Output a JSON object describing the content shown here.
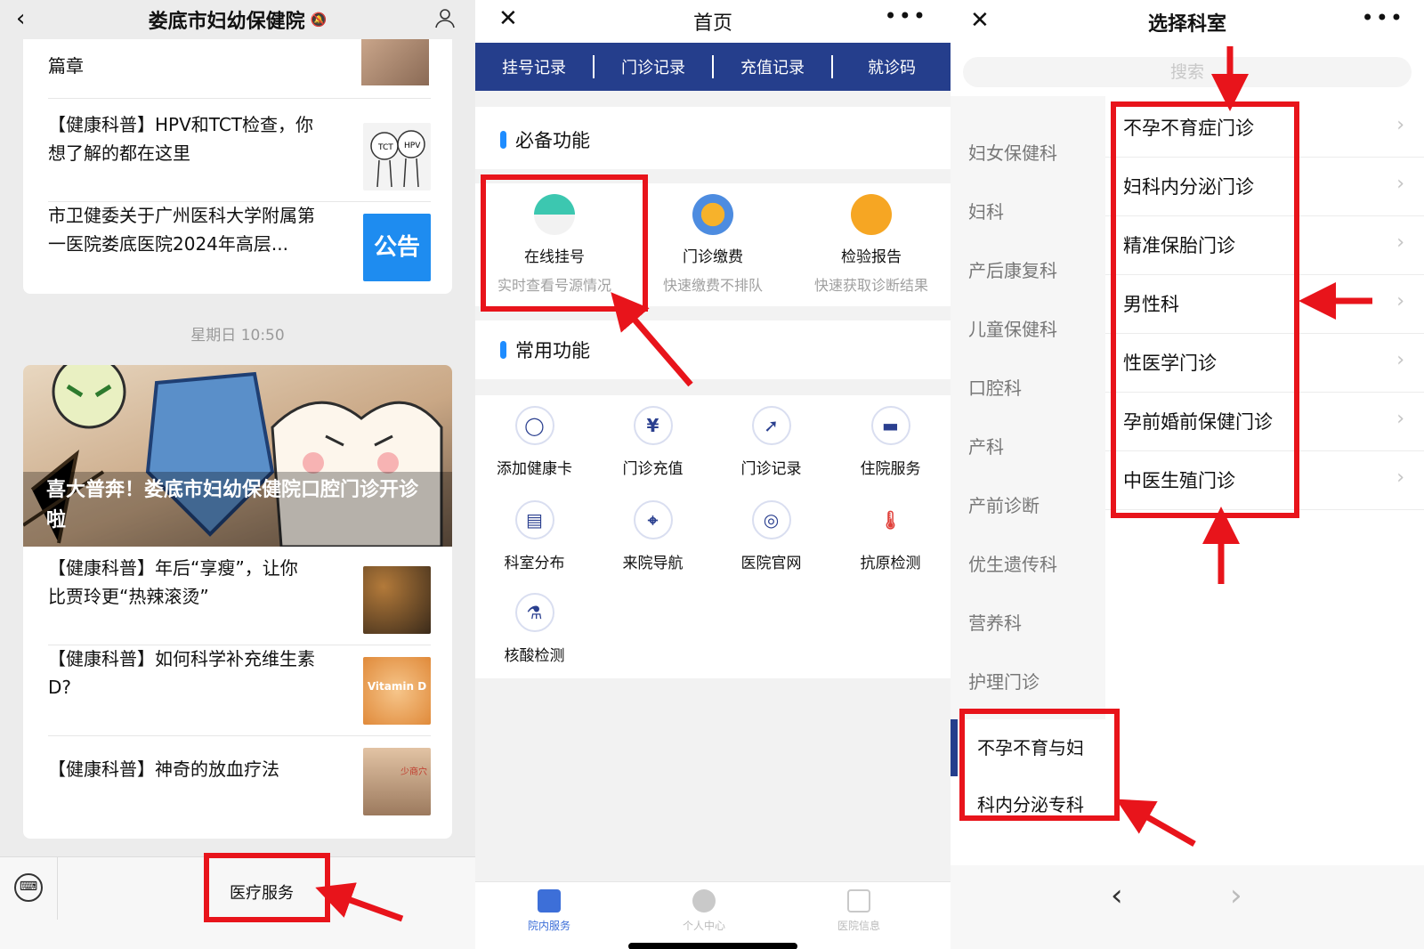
{
  "panel1": {
    "title": "娄底市妇幼保健院",
    "top_fragment": "篇章",
    "articles_top": [
      "【健康科普】HPV和TCT检查，你想了解的都在这里",
      "市卫健委关于广州医科大学附属第一医院娄底医院2024年高层..."
    ],
    "thumb_notice": "公告",
    "thumb_hpv": [
      "TCT",
      "HPV"
    ],
    "timestamp": "星期日 10:50",
    "banner_caption": "喜大普奔！娄底市妇幼保健院口腔门诊开诊啦",
    "articles_bottom": [
      "【健康科普】年后“享瘦”，让你比贾玲更“热辣滚烫”",
      "【健康科普】如何科学补充维生素D?",
      "【健康科普】神奇的放血疗法"
    ],
    "thumb_vitamin": "Vitamin D",
    "thumb_acupoint": "少商穴",
    "menu_button": "医疗服务"
  },
  "panel2": {
    "title": "首页",
    "tabs": [
      "挂号记录",
      "门诊记录",
      "充值记录",
      "就诊码"
    ],
    "section_required": "必备功能",
    "features": [
      {
        "name": "在线挂号",
        "sub": "实时查看号源情况"
      },
      {
        "name": "门诊缴费",
        "sub": "快速缴费不排队"
      },
      {
        "name": "检验报告",
        "sub": "快速获取诊断结果"
      }
    ],
    "section_common": "常用功能",
    "grid": [
      "添加健康卡",
      "门诊充值",
      "门诊记录",
      "住院服务",
      "科室分布",
      "来院导航",
      "医院官网",
      "抗原检测",
      "核酸检测"
    ],
    "bottom_nav": [
      "院内服务",
      "个人中心",
      "医院信息"
    ]
  },
  "panel3": {
    "title": "选择科室",
    "search_placeholder": "搜索",
    "sidebar": [
      "妇女保健科",
      "妇科",
      "产后康复科",
      "儿童保健科",
      "口腔科",
      "产科",
      "产前诊断",
      "优生遗传科",
      "营养科",
      "护理门诊"
    ],
    "sidebar_selected": [
      "不孕不育与妇",
      "科内分泌专科"
    ],
    "clinics": [
      "不孕不育症门诊",
      "妇科内分泌门诊",
      "精准保胎门诊",
      "男性科",
      "性医学门诊",
      "孕前婚前保健门诊",
      "中医生殖门诊"
    ]
  },
  "colors": {
    "highlight": "#e8141b",
    "brand_blue": "#253e8c",
    "accent_blue": "#1e8cff"
  }
}
